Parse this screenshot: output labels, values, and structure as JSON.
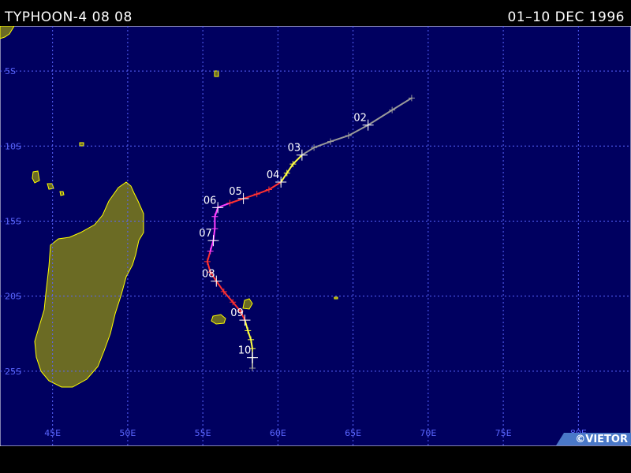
{
  "header": {
    "title": "TYPHOON-4 08 08",
    "period": "01–10 DEC 1996"
  },
  "credit": "©VIETOR",
  "map": {
    "ocean_color": "#000060",
    "land_color": "#6b6b24",
    "coast_color": "#ffff00",
    "grid_color": "#5a66ff",
    "lon_range": [
      41.5,
      83.5
    ],
    "lat_range": [
      -2,
      -30
    ],
    "lon_ticks": [
      {
        "value": 45,
        "label": "45E"
      },
      {
        "value": 50,
        "label": "50E"
      },
      {
        "value": 55,
        "label": "55E"
      },
      {
        "value": 60,
        "label": "60E"
      },
      {
        "value": 65,
        "label": "65E"
      },
      {
        "value": 70,
        "label": "70E"
      },
      {
        "value": 75,
        "label": "75E"
      },
      {
        "value": 80,
        "label": "80E"
      }
    ],
    "lat_ticks": [
      {
        "value": -5,
        "label": "5S"
      },
      {
        "value": -10,
        "label": "10S"
      },
      {
        "value": -15,
        "label": "15S"
      },
      {
        "value": -20,
        "label": "20S"
      },
      {
        "value": -25,
        "label": "25S"
      }
    ]
  },
  "track": {
    "intensity_colors": {
      "depression": "#9a9a9a",
      "storm": "#ffff40",
      "cat1": "#ff3030",
      "cat2": "#ff40ff"
    },
    "points": [
      {
        "lon": 68.9,
        "lat": -6.8,
        "intensity": "depression"
      },
      {
        "lon": 67.6,
        "lat": -7.6,
        "intensity": "depression"
      },
      {
        "lon": 66.0,
        "lat": -8.6,
        "intensity": "depression"
      },
      {
        "lon": 64.7,
        "lat": -9.3,
        "intensity": "depression"
      },
      {
        "lon": 63.5,
        "lat": -9.7,
        "intensity": "depression"
      },
      {
        "lon": 62.4,
        "lat": -10.1,
        "intensity": "depression"
      },
      {
        "lon": 61.6,
        "lat": -10.6,
        "intensity": "depression"
      },
      {
        "lon": 61.0,
        "lat": -11.2,
        "intensity": "storm"
      },
      {
        "lon": 60.6,
        "lat": -11.8,
        "intensity": "storm"
      },
      {
        "lon": 60.2,
        "lat": -12.4,
        "intensity": "storm"
      },
      {
        "lon": 59.4,
        "lat": -12.9,
        "intensity": "cat1"
      },
      {
        "lon": 58.6,
        "lat": -13.2,
        "intensity": "cat1"
      },
      {
        "lon": 57.7,
        "lat": -13.5,
        "intensity": "cat1"
      },
      {
        "lon": 56.8,
        "lat": -13.8,
        "intensity": "cat1"
      },
      {
        "lon": 56.0,
        "lat": -14.1,
        "intensity": "cat2"
      },
      {
        "lon": 55.8,
        "lat": -14.7,
        "intensity": "cat2"
      },
      {
        "lon": 55.8,
        "lat": -15.5,
        "intensity": "cat2"
      },
      {
        "lon": 55.7,
        "lat": -16.3,
        "intensity": "cat2"
      },
      {
        "lon": 55.5,
        "lat": -17.0,
        "intensity": "cat2"
      },
      {
        "lon": 55.3,
        "lat": -17.7,
        "intensity": "cat1"
      },
      {
        "lon": 55.5,
        "lat": -18.4,
        "intensity": "cat1"
      },
      {
        "lon": 55.9,
        "lat": -19.0,
        "intensity": "cat1"
      },
      {
        "lon": 56.4,
        "lat": -19.7,
        "intensity": "cat1"
      },
      {
        "lon": 57.0,
        "lat": -20.4,
        "intensity": "cat1"
      },
      {
        "lon": 57.5,
        "lat": -21.0,
        "intensity": "cat1"
      },
      {
        "lon": 57.8,
        "lat": -21.6,
        "intensity": "cat1"
      },
      {
        "lon": 58.0,
        "lat": -22.3,
        "intensity": "storm"
      },
      {
        "lon": 58.2,
        "lat": -22.9,
        "intensity": "storm"
      },
      {
        "lon": 58.3,
        "lat": -23.5,
        "intensity": "storm"
      },
      {
        "lon": 58.3,
        "lat": -24.1,
        "intensity": "depression"
      },
      {
        "lon": 58.3,
        "lat": -24.8,
        "intensity": "depression"
      }
    ],
    "day_labels": [
      {
        "label": "02",
        "lon": 66.0,
        "lat": -8.6
      },
      {
        "label": "03",
        "lon": 61.6,
        "lat": -10.6
      },
      {
        "label": "04",
        "lon": 60.2,
        "lat": -12.4
      },
      {
        "label": "05",
        "lon": 57.7,
        "lat": -13.5
      },
      {
        "label": "06",
        "lon": 56.0,
        "lat": -14.1
      },
      {
        "label": "07",
        "lon": 55.7,
        "lat": -16.3
      },
      {
        "label": "08",
        "lon": 55.9,
        "lat": -19.0
      },
      {
        "label": "09",
        "lon": 57.8,
        "lat": -21.6
      },
      {
        "label": "10",
        "lon": 58.3,
        "lat": -24.1
      }
    ]
  }
}
